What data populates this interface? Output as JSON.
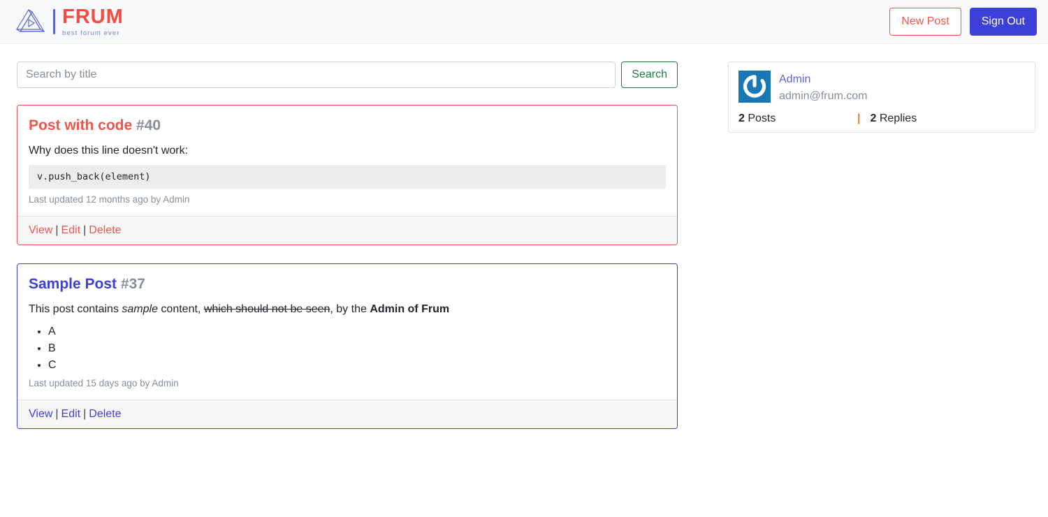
{
  "brand": {
    "title": "FRUM",
    "tagline": "best forum ever",
    "logo_icon": "frum-triangle-play-logo"
  },
  "nav": {
    "new_post_label": "New Post",
    "sign_out_label": "Sign Out"
  },
  "search": {
    "placeholder": "Search by title",
    "value": "",
    "button_label": "Search"
  },
  "posts": [
    {
      "theme": "red",
      "title": "Post with code",
      "number": "#40",
      "intro": "Why does this line doesn't work:",
      "code": "v.push_back(element)",
      "meta": "Last updated 12 months ago by Admin",
      "actions": {
        "view": "View",
        "edit": "Edit",
        "delete": "Delete",
        "separator": "|"
      }
    },
    {
      "theme": "blue",
      "title": "Sample Post",
      "number": "#37",
      "body_parts": {
        "lead": "This post contains ",
        "italic": "sample",
        "mid": " content, ",
        "strike": "which should not be seen",
        "tail": ", by the ",
        "bold": "Admin of Frum"
      },
      "bullets": [
        "A",
        "B",
        "C"
      ],
      "meta": "Last updated 15 days ago by Admin",
      "actions": {
        "view": "View",
        "edit": "Edit",
        "delete": "Delete",
        "separator": "|"
      }
    }
  ],
  "profile": {
    "avatar_icon": "gravatar-power-logo",
    "name": "Admin",
    "email": "admin@frum.com",
    "posts_count": "2",
    "posts_label": "Posts",
    "replies_count": "2",
    "replies_label": "Replies",
    "stats_separator": "|"
  },
  "colors": {
    "brand_red": "#f2544b",
    "brand_indigo": "#3c40d8",
    "search_green": "#1d7a43",
    "avatar_blue": "#1778b5",
    "muted_gray": "#868e96",
    "header_bg": "#f8f9fa"
  }
}
